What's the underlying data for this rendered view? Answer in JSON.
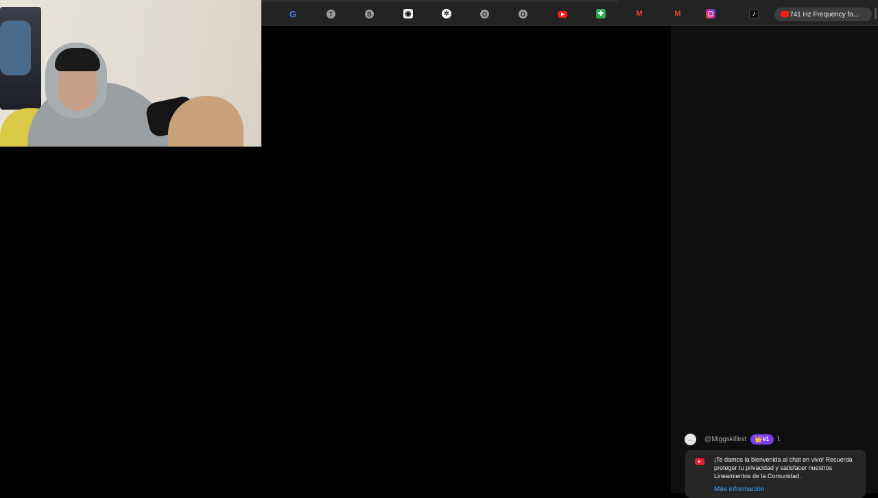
{
  "bookmarks": [
    {
      "icon": "google-icon",
      "glyph": "G"
    },
    {
      "icon": "bookmark-t-icon",
      "glyph": "T"
    },
    {
      "icon": "bookmark-b-icon",
      "glyph": "B"
    },
    {
      "icon": "panda-icon",
      "glyph": "◉"
    },
    {
      "icon": "chatgpt-icon",
      "glyph": "✲"
    },
    {
      "icon": "bookmark-o-icon",
      "glyph": "O"
    },
    {
      "icon": "bookmark-o2-icon",
      "glyph": "O"
    },
    {
      "icon": "youtube-icon",
      "glyph": ""
    },
    {
      "icon": "green-app-icon",
      "glyph": "✚"
    },
    {
      "icon": "gmail-icon",
      "glyph": "M"
    },
    {
      "icon": "gmail2-icon",
      "glyph": "M"
    },
    {
      "icon": "instagram-icon",
      "glyph": ""
    },
    {
      "icon": "tiktok-icon",
      "glyph": "♪"
    }
  ],
  "active_tab": {
    "label": "741 Hz Frequency fo..."
  },
  "chat": {
    "message": {
      "username": "@Miggskillinit",
      "badge": "👑#1",
      "text": "\\"
    },
    "welcome": {
      "text": "¡Te damos la bienvenida al chat en vivo! Recuerda proteger tu privacidad y satisfacer nuestros Lineamientos de la Comunidad.",
      "link": "Más información"
    }
  },
  "colors": {
    "youtube_red": "#ff1a1a",
    "badge_purple": "#7b3cf0",
    "link_blue": "#3ea6ff"
  }
}
